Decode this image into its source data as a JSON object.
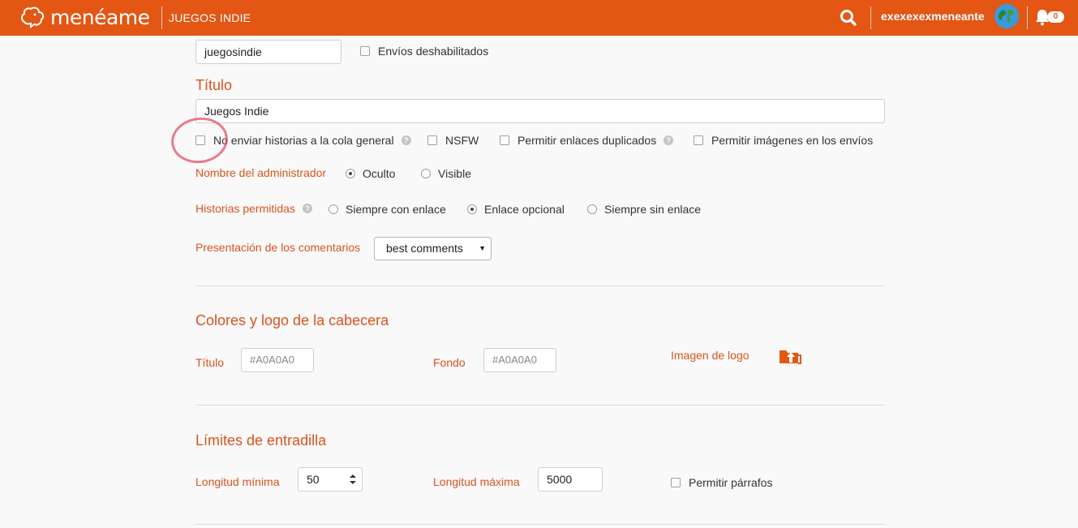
{
  "header": {
    "logo_text": "menéame",
    "sub_name": "JUEGOS INDIE",
    "username": "exexexexmeneante",
    "notifications_count": "0",
    "brand_color": "#e35614"
  },
  "form": {
    "sub_short_name_value": "juegosindie",
    "envios_deshabilitados_label": "Envíos deshabilitados",
    "titulo_heading": "Título",
    "titulo_value": "Juegos Indie",
    "options": {
      "no_enviar_cola_label": "No enviar historias a la cola general",
      "nsfw_label": "NSFW",
      "permitir_duplicados_label": "Permitir enlaces duplicados",
      "permitir_imagenes_label": "Permitir imágenes en los envíos"
    },
    "admin_name_label": "Nombre del administrador",
    "admin_oculto_label": "Oculto",
    "admin_visible_label": "Visible",
    "admin_selected": "Oculto",
    "historias_label": "Historias permitidas",
    "historias_siempre_con_label": "Siempre con enlace",
    "historias_opcional_label": "Enlace opcional",
    "historias_siempre_sin_label": "Siempre sin enlace",
    "historias_selected": "Enlace opcional",
    "comentarios_label": "Presentación de los comentarios",
    "comentarios_value": "best comments"
  },
  "colores": {
    "heading": "Colores y logo de la cabecera",
    "titulo_label": "Título",
    "titulo_placeholder": "#A0A0A0",
    "fondo_label": "Fondo",
    "fondo_placeholder": "#A0A0A0",
    "logo_label": "Imagen de logo"
  },
  "limites": {
    "heading": "Límites de entradilla",
    "min_label": "Longitud mínima",
    "min_value": "50",
    "max_label": "Longitud máxima",
    "max_value": "5000",
    "parrafos_label": "Permitir párrafos"
  }
}
